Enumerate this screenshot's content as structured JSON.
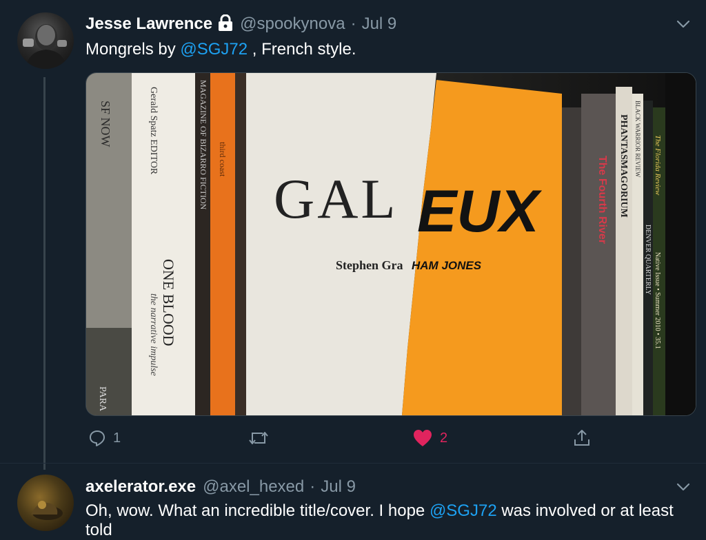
{
  "tweets": [
    {
      "name": "Jesse Lawrence",
      "handle": "@spookynova",
      "separator": "·",
      "date": "Jul 9",
      "protected": true,
      "text_before": "Mongrels by ",
      "mention": "@SGJ72",
      "text_after": " , French style.",
      "image": {
        "description_icons": "book-shelf-photo",
        "cover_title_left": "GAL",
        "cover_title_right": "EUX",
        "cover_author_left": "Stephen Gra",
        "cover_author_right": "HAM JONES",
        "spines": [
          "SF NOW",
          "Gerald Spatz EDITOR",
          "ONE BLOOD",
          "the narrative impulse",
          "MAGAZINE OF BIZARRO FICTION",
          "third coast",
          "The Fourth River",
          "PHANTASMAGORIUM",
          "BLACK WARRIOR REVIEW",
          "DENVER QUARTERLY",
          "The Florida Review",
          "Native Issue • Summer 2010 • 35.1",
          "PARA"
        ]
      },
      "actions": {
        "reply_count": "1",
        "retweet_count": "",
        "like_count": "2"
      }
    },
    {
      "name": "axelerator.exe",
      "handle": "@axel_hexed",
      "separator": "·",
      "date": "Jul 9",
      "text_before": "Oh, wow. What an incredible title/cover. I hope ",
      "mention": "@SGJ72",
      "text_after": " was involved or at least",
      "text_line2": "told"
    }
  ],
  "colors": {
    "background": "#15202b",
    "accent": "#1da1f2",
    "like": "#e0245e",
    "muted": "#8899a6",
    "cover_orange": "#f59a1e"
  }
}
